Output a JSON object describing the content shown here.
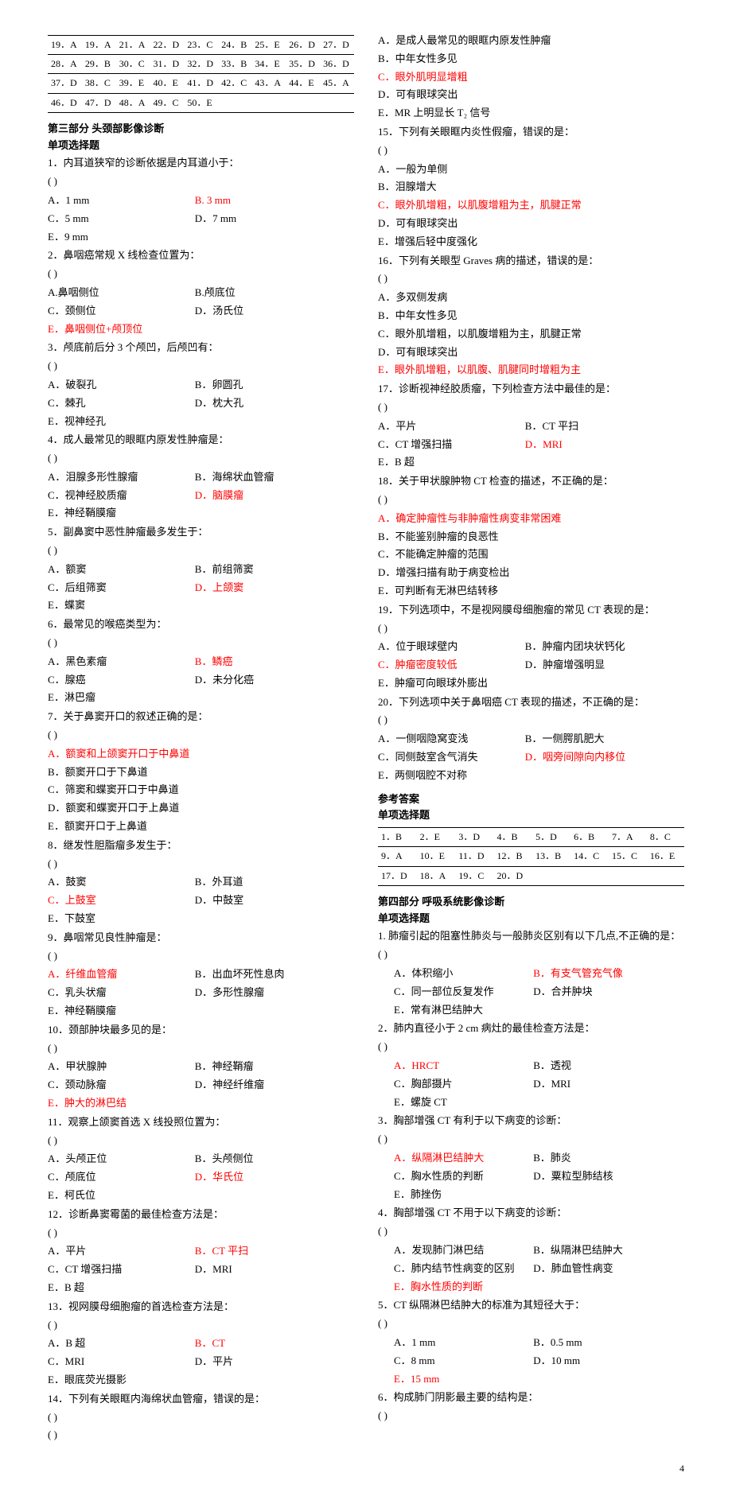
{
  "topAnswers": [
    [
      "19．A",
      "19．A",
      "21．A",
      "22．D",
      "23．C",
      "24．B",
      "25．E",
      "26．D",
      "27．D"
    ],
    [
      "28．A",
      "29．B",
      "30．C",
      "31．D",
      "32．D",
      "33．B",
      "34．E",
      "35．D",
      "36．D"
    ],
    [
      "37．D",
      "38．C",
      "39．E",
      "40．E",
      "41．D",
      "42．C",
      "43．A",
      "44．E",
      "45．A"
    ],
    [
      "46．D",
      "47．D",
      "48．A",
      "49．C",
      "50．E",
      "",
      "",
      "",
      ""
    ]
  ],
  "part3": {
    "title": "第三部分   头颈部影像诊断",
    "sub": "单项选择题"
  },
  "p3": [
    {
      "q": "1．内耳道狭窄的诊断依据是内耳道小于：",
      "opts": [
        {
          "t": "A．1 mm"
        },
        {
          "t": "B. 3 mm",
          "r": 1
        },
        {
          "t": "C．5 mm"
        },
        {
          "t": "D．7 mm"
        },
        {
          "t": "E．9 mm",
          "f": 1
        }
      ]
    },
    {
      "q": "2．鼻咽癌常规 X 线检查位置为：",
      "opts": [
        {
          "t": "A.鼻咽侧位"
        },
        {
          "t": "B.颅底位"
        },
        {
          "t": "C．颈侧位"
        },
        {
          "t": "D．汤氏位"
        },
        {
          "t": "E．鼻咽侧位+颅顶位",
          "r": 1,
          "f": 1
        }
      ]
    },
    {
      "q": "3．颅底前后分 3 个颅凹，后颅凹有：",
      "opts": [
        {
          "t": "A．破裂孔"
        },
        {
          "t": "B．卵圆孔"
        },
        {
          "t": "C．棘孔"
        },
        {
          "t": "D．枕大孔"
        },
        {
          "t": "E．视神经孔",
          "f": 1
        }
      ]
    },
    {
      "q": "4．成人最常见的眼眶内原发性肿瘤是：",
      "opts": [
        {
          "t": "A．泪腺多形性腺瘤"
        },
        {
          "t": "B．海绵状血管瘤"
        },
        {
          "t": "C．视神经胶质瘤"
        },
        {
          "t": "D．脑膜瘤",
          "r": 1
        },
        {
          "t": "E．神经鞘膜瘤",
          "f": 1
        }
      ]
    },
    {
      "q": "5．副鼻窦中恶性肿瘤最多发生于：",
      "opts": [
        {
          "t": "A．额窦"
        },
        {
          "t": "B．前组筛窦"
        },
        {
          "t": "C．后组筛窦"
        },
        {
          "t": "D．上颌窦",
          "r": 1
        },
        {
          "t": "E．蝶窦",
          "f": 1
        }
      ]
    },
    {
      "q": "6．最常见的喉癌类型为：",
      "opts": [
        {
          "t": "A．黑色素瘤"
        },
        {
          "t": "B．鳞癌",
          "r": 1
        },
        {
          "t": "C．腺癌"
        },
        {
          "t": "D．未分化癌"
        },
        {
          "t": "E．淋巴瘤",
          "f": 1
        }
      ]
    },
    {
      "q": "7．关于鼻窦开口的叙述正确的是：",
      "opts": [
        {
          "t": "A．额窦和上颌窦开口于中鼻道",
          "r": 1,
          "f": 1
        },
        {
          "t": "B．额窦开口于下鼻道",
          "f": 1
        },
        {
          "t": "C．筛窦和蝶窦开口于中鼻道",
          "f": 1
        },
        {
          "t": "D．额窦和蝶窦开口于上鼻道",
          "f": 1
        },
        {
          "t": "E．额窦开口于上鼻道",
          "f": 1
        }
      ]
    },
    {
      "q": "8．继发性胆脂瘤多发生于：",
      "opts": [
        {
          "t": "A．鼓窦"
        },
        {
          "t": "B．外耳道"
        },
        {
          "t": "C．上鼓室",
          "r": 1
        },
        {
          "t": "D．中鼓室"
        },
        {
          "t": "E．下鼓室",
          "f": 1
        }
      ]
    },
    {
      "q": "9．鼻咽常见良性肿瘤是：",
      "opts": [
        {
          "t": "A．纤维血管瘤",
          "r": 1
        },
        {
          "t": "B．出血坏死性息肉"
        },
        {
          "t": "C．乳头状瘤"
        },
        {
          "t": "D．多形性腺瘤"
        },
        {
          "t": "E．神经鞘膜瘤",
          "f": 1
        }
      ]
    },
    {
      "q": "10．颈部肿块最多见的是：",
      "opts": [
        {
          "t": "A．甲状腺肿"
        },
        {
          "t": "B．神经鞘瘤"
        },
        {
          "t": "C．颈动脉瘤"
        },
        {
          "t": "D．神经纤维瘤"
        },
        {
          "t": "E．肿大的淋巴结",
          "r": 1,
          "f": 1
        }
      ]
    },
    {
      "q": "11．观察上颌窦首选 X 线投照位置为：",
      "opts": [
        {
          "t": "A．头颅正位"
        },
        {
          "t": "B．头颅侧位"
        },
        {
          "t": "C．颅底位"
        },
        {
          "t": "D．华氏位",
          "r": 1
        },
        {
          "t": "E．柯氏位",
          "f": 1
        }
      ]
    },
    {
      "q": "12．诊断鼻窦霉菌的最佳检查方法是：",
      "opts": [
        {
          "t": "A．平片"
        },
        {
          "t": "B．CT 平扫",
          "r": 1
        },
        {
          "t": "C．CT 增强扫描"
        },
        {
          "t": "D．MRI"
        },
        {
          "t": "E．B 超",
          "f": 1
        }
      ]
    },
    {
      "q": "13．视网膜母细胞瘤的首选检查方法是：",
      "opts": [
        {
          "t": "A．B 超"
        },
        {
          "t": "B．CT",
          "r": 1
        },
        {
          "t": "C．MRI"
        },
        {
          "t": "D．平片"
        },
        {
          "t": "E．眼底荧光摄影",
          "f": 1
        }
      ]
    },
    {
      "q": "14．下列有关眼眶内海绵状血管瘤，错误的是："
    }
  ],
  "p3r": [
    {
      "opts": [
        {
          "t": "A．是成人最常见的眼眶内原发性肿瘤",
          "f": 1
        },
        {
          "t": "B．中年女性多见",
          "f": 1
        },
        {
          "t": "C．眼外肌明显增粗",
          "r": 1,
          "f": 1
        },
        {
          "t": "D．可有眼球突出",
          "f": 1
        },
        {
          "t": "E．MR 上明显长 T₂ 信号",
          "f": 1
        }
      ]
    },
    {
      "q": "15．下列有关眼眶内炎性假瘤，错误的是：",
      "opts": [
        {
          "t": "A．一般为单侧",
          "f": 1
        },
        {
          "t": "B．泪腺增大",
          "f": 1
        },
        {
          "t": "C．眼外肌增粗，以肌腹增粗为主，肌腱正常",
          "r": 1,
          "f": 1
        },
        {
          "t": "D．可有眼球突出",
          "f": 1
        },
        {
          "t": "E．增强后轻中度强化",
          "f": 1
        }
      ]
    },
    {
      "q": "16．下列有关眼型 Graves 病的描述，错误的是：",
      "opts": [
        {
          "t": "A．多双侧发病",
          "f": 1
        },
        {
          "t": "B．中年女性多见",
          "f": 1
        },
        {
          "t": "C．眼外肌增粗，以肌腹增粗为主，肌腱正常",
          "f": 1
        },
        {
          "t": "D．可有眼球突出",
          "f": 1
        },
        {
          "t": "E．眼外肌增粗，以肌腹、肌腱同时增粗为主",
          "r": 1,
          "f": 1
        }
      ]
    },
    {
      "q": "17．诊断视神经胶质瘤，下列检查方法中最佳的是：",
      "opts": [
        {
          "t": "A．平片"
        },
        {
          "t": "B．CT 平扫"
        },
        {
          "t": "C．CT 增强扫描"
        },
        {
          "t": "D．MRI",
          "r": 1
        },
        {
          "t": "E．B 超",
          "f": 1
        }
      ]
    },
    {
      "q": "18．关于甲状腺肿物 CT 检查的描述，不正确的是：",
      "opts": [
        {
          "t": "A．确定肿瘤性与非肿瘤性病变非常困难",
          "r": 1,
          "f": 1
        },
        {
          "t": "B．不能鉴别肿瘤的良恶性",
          "f": 1
        },
        {
          "t": "C．不能确定肿瘤的范围",
          "f": 1
        },
        {
          "t": "D．增强扫描有助于病变检出",
          "f": 1
        },
        {
          "t": "E．可判断有无淋巴结转移",
          "f": 1
        }
      ]
    },
    {
      "q": "19．下列选项中，不是视网膜母细胞瘤的常见 CT 表现的是：",
      "opts": [
        {
          "t": "A．位于眼球壁内"
        },
        {
          "t": "B．肿瘤内团块状钙化"
        },
        {
          "t": "C．肿瘤密度较低",
          "r": 1
        },
        {
          "t": "D．肿瘤增强明显"
        },
        {
          "t": "E．肿瘤可向眼球外膨出",
          "f": 1
        }
      ]
    },
    {
      "q": "20．下列选项中关于鼻咽癌 CT 表现的描述，不正确的是：",
      "opts": [
        {
          "t": "A．一侧咽隐窝变浅"
        },
        {
          "t": "B．一侧腭肌肥大"
        },
        {
          "t": "C．同侧鼓室含气消失"
        },
        {
          "t": "D．咽旁间隙向内移位",
          "r": 1
        },
        {
          "t": "E．两侧咽腔不对称",
          "f": 1
        }
      ]
    }
  ],
  "refTitle": "参考答案",
  "refSub": "单项选择题",
  "refAns": [
    [
      "1．B",
      "2．E",
      "3．D",
      "4．B",
      "5．D",
      "6．B",
      "7．A",
      "8．C"
    ],
    [
      "9．A",
      "10．E",
      "11．D",
      "12．B",
      "13．B",
      "14．C",
      "15．C",
      "16．E"
    ],
    [
      "17．D",
      "18．A",
      "19．C",
      "20．D",
      "",
      "",
      "",
      ""
    ]
  ],
  "part4": {
    "title": "第四部分   呼吸系统影像诊断",
    "sub": "单项选择题"
  },
  "p4": [
    {
      "q": "1. 肺瘤引起的阻塞性肺炎与一般肺炎区别有以下几点,不正确的是：",
      "opts": [
        {
          "t": "A．体积缩小"
        },
        {
          "t": "B．有支气管充气像",
          "r": 1
        },
        {
          "t": "C．同一部位反复发作"
        },
        {
          "t": "D．合并肿块"
        },
        {
          "t": "E．常有淋巴结肿大",
          "f": 1
        }
      ],
      "indent": 1
    },
    {
      "q": "2．肺内直径小于 2 cm 病灶的最佳检查方法是：",
      "opts": [
        {
          "t": "A．HRCT",
          "r": 1
        },
        {
          "t": "B．透视"
        },
        {
          "t": "C．胸部摄片"
        },
        {
          "t": "D．MRI"
        },
        {
          "t": "E．螺旋 CT",
          "f": 1
        }
      ],
      "indent": 1
    },
    {
      "q": "3．胸部增强 CT 有利于以下病变的诊断：",
      "opts": [
        {
          "t": "A．纵隔淋巴结肿大",
          "r": 1
        },
        {
          "t": "B．肺炎"
        },
        {
          "t": "C．胸水性质的判断"
        },
        {
          "t": "D．粟粒型肺结核"
        },
        {
          "t": "E．肺挫伤",
          "f": 1
        }
      ],
      "indent": 1
    },
    {
      "q": "4．胸部增强 CT 不用于以下病变的诊断：",
      "opts": [
        {
          "t": "A．发现肺门淋巴结"
        },
        {
          "t": "B．纵隔淋巴结肿大"
        },
        {
          "t": "C．肺内结节性病变的区别"
        },
        {
          "t": "D．肺血管性病变"
        },
        {
          "t": "E．胸水性质的判断",
          "r": 1,
          "f": 1
        }
      ],
      "indent": 1
    },
    {
      "q": "5．CT 纵隔淋巴结肿大的标准为其短径大于：",
      "opts": [
        {
          "t": "A．1 mm"
        },
        {
          "t": "B．0.5 mm"
        },
        {
          "t": "C．8 mm"
        },
        {
          "t": "D．10 mm"
        },
        {
          "t": "E．15 mm",
          "r": 1,
          "f": 1
        }
      ],
      "indent": 1
    },
    {
      "q": "6．构成肺门阴影最主要的结构是："
    }
  ],
  "paren": "(        )",
  "pagenum": "4"
}
